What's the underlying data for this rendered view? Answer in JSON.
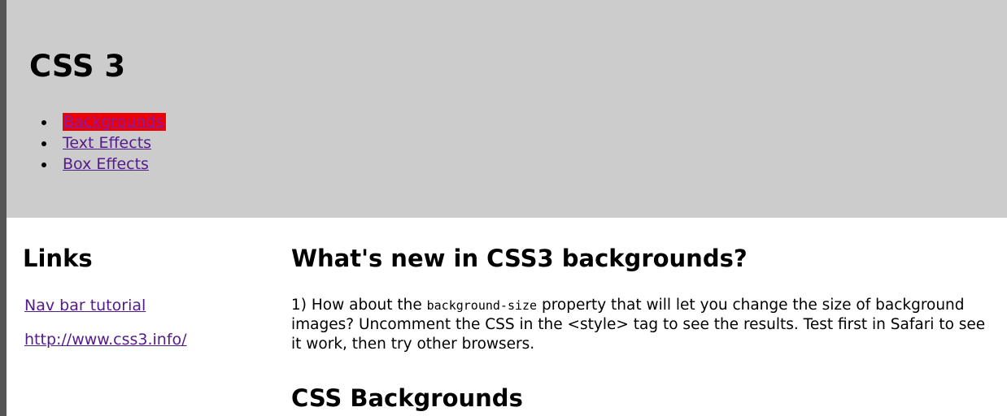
{
  "header": {
    "title": "CSS 3",
    "nav": [
      {
        "label": "Backgrounds",
        "active": true
      },
      {
        "label": "Text Effects",
        "active": false
      },
      {
        "label": "Box Effects",
        "active": false
      }
    ]
  },
  "sidebar": {
    "heading": "Links",
    "links": [
      {
        "label": "Nav bar tutorial"
      },
      {
        "label": "http://www.css3.info/"
      }
    ]
  },
  "main": {
    "heading": "What's new in CSS3 backgrounds?",
    "paragraph": {
      "prefix": "1) How about the ",
      "code": "background-size",
      "suffix": " property that will let you change the size of background images? Uncomment the CSS in the <style> tag to see the results. Test first in Safari to see it work, then try other browsers."
    },
    "subheading": "CSS Backgrounds"
  },
  "colors": {
    "header_bg": "#cccccc",
    "link": "#551a8b",
    "active_highlight": "#ee0000"
  }
}
